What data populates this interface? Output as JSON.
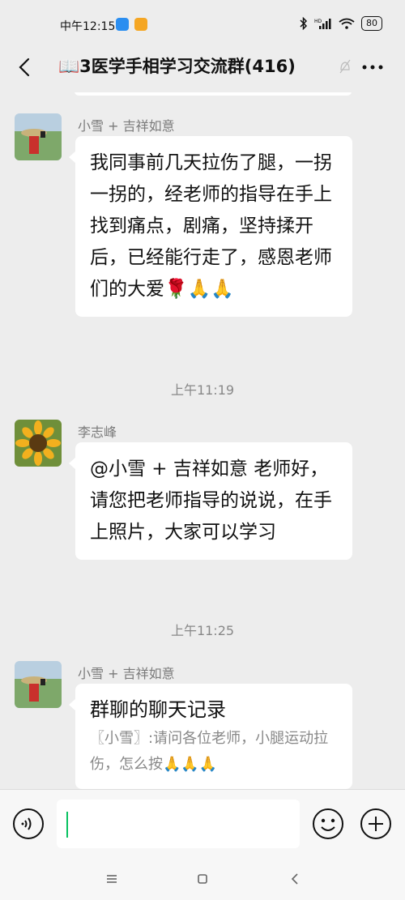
{
  "status_bar": {
    "time": "中午12:15",
    "battery": "80",
    "network_label": "HD"
  },
  "header": {
    "title": "📖3医学手相学习交流群(416)"
  },
  "messages": [
    {
      "sender": "小雪 + 吉祥如意",
      "text": "我同事前几天拉伤了腿，一拐一拐的，经老师的指导在手上找到痛点，剧痛，坚持揉开后，已经能行走了，感恩老师们的大爱🌹🙏🙏"
    },
    {
      "timestamp": "上午11:19"
    },
    {
      "sender": "李志峰",
      "text": "@小雪 + 吉祥如意  老师好，请您把老师指导的说说，在手上照片，大家可以学习"
    },
    {
      "timestamp": "上午11:25"
    },
    {
      "sender": "小雪 + 吉祥如意",
      "card_title": "群聊的聊天记录",
      "card_body": "〖小雪〗:请问各位老师，小腿运动拉伤，怎么按🙏🙏🙏"
    }
  ],
  "input": {
    "value": ""
  },
  "colors": {
    "background": "#ededed",
    "bubble": "#ffffff",
    "accent_green": "#07c160"
  }
}
